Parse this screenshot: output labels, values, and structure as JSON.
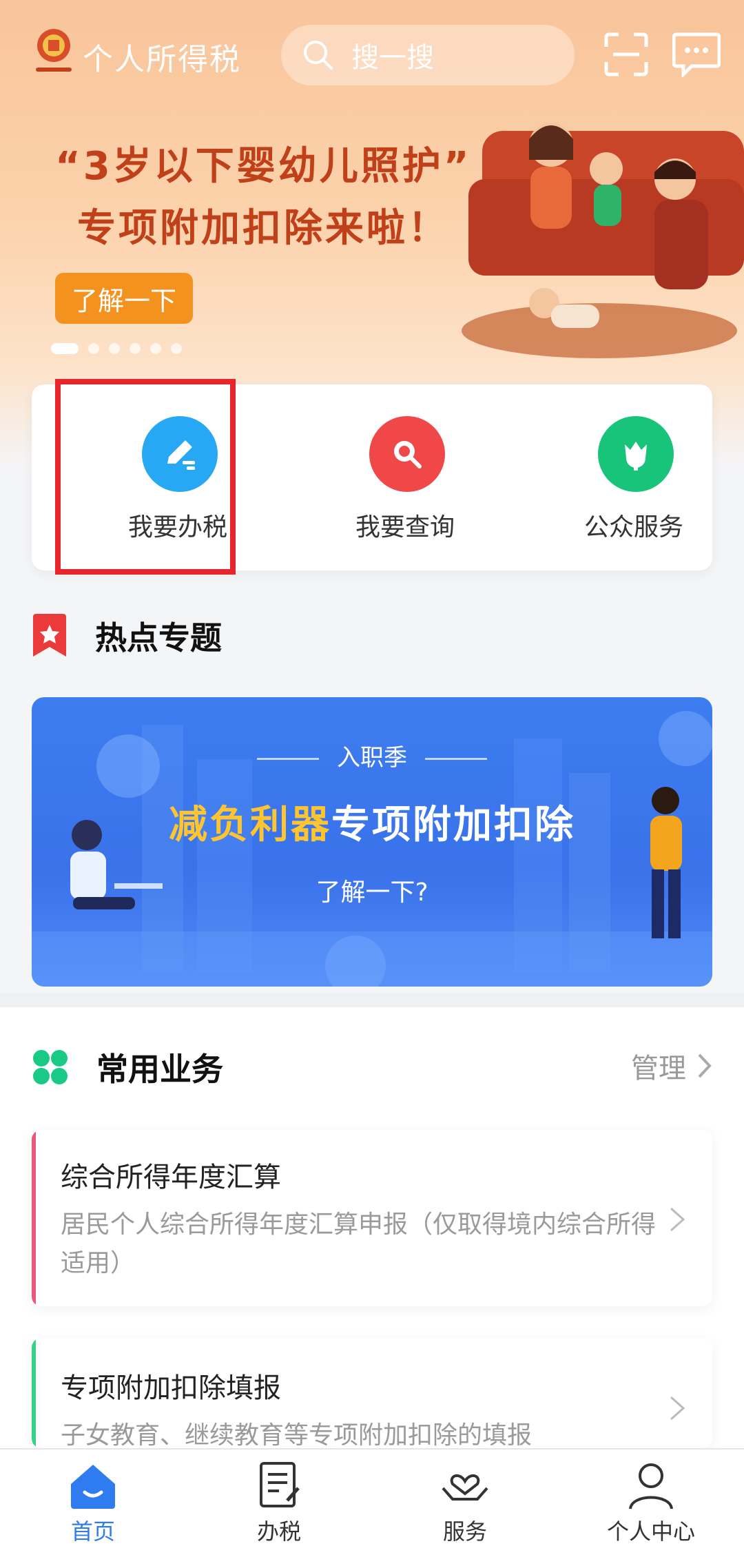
{
  "header": {
    "app_title": "个人所得税",
    "search_placeholder": "搜一搜"
  },
  "promo": {
    "line1": "“3岁以下婴幼儿照护”",
    "line2": "专项附加扣除来啦！",
    "button": "了解一下"
  },
  "quick_actions": [
    {
      "label": "我要办税",
      "icon": "edit-icon",
      "color": "#27a8f5"
    },
    {
      "label": "我要查询",
      "icon": "search-icon",
      "color": "#f04848"
    },
    {
      "label": "公众服务",
      "icon": "tulip-icon",
      "color": "#17c47a"
    }
  ],
  "hot_topics": {
    "title": "热点专题",
    "banner": {
      "subtitle": "入职季",
      "title_accent": "减负利器",
      "title_rest": "专项附加扣除",
      "question": "了解一下?"
    }
  },
  "common": {
    "title": "常用业务",
    "manage": "管理",
    "items": [
      {
        "title": "综合所得年度汇算",
        "desc": "居民个人综合所得年度汇算申报（仅取得境内综合所得适用）",
        "color": "#e8587a"
      },
      {
        "title": "专项附加扣除填报",
        "desc": "子女教育、继续教育等专项附加扣除的填报",
        "color": "#34d28a"
      }
    ]
  },
  "nav": [
    {
      "label": "首页",
      "icon": "home-icon",
      "active": true
    },
    {
      "label": "办税",
      "icon": "tax-form-icon"
    },
    {
      "label": "服务",
      "icon": "heart-hands-icon"
    },
    {
      "label": "个人中心",
      "icon": "user-icon"
    }
  ],
  "colors": {
    "accent": "#2f7cf0",
    "promo_text": "#c0401a",
    "highlight": "#e8252a"
  }
}
